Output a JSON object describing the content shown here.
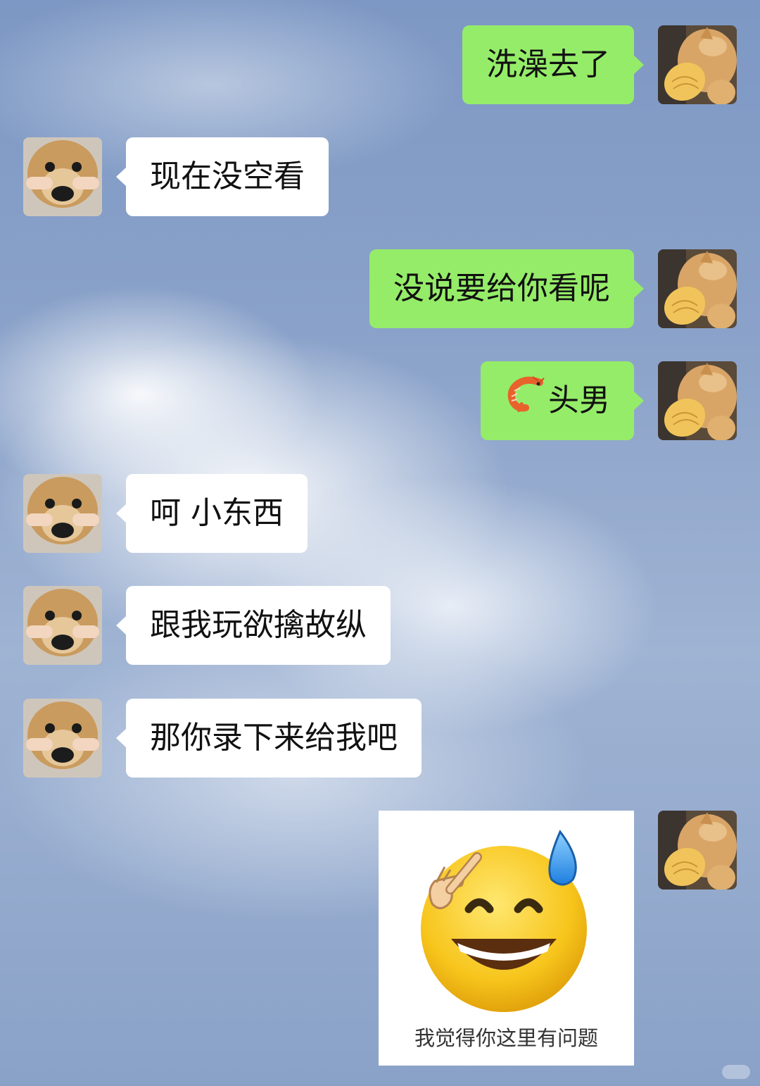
{
  "messages": [
    {
      "side": "out",
      "text": "洗澡去了"
    },
    {
      "side": "in",
      "text": "现在没空看"
    },
    {
      "side": "out",
      "text": "没说要给你看呢"
    },
    {
      "side": "out",
      "text": "头男",
      "prefix_icon": "shrimp-emoji"
    },
    {
      "side": "in",
      "text": "呵 小东西"
    },
    {
      "side": "in",
      "text": "跟我玩欲擒故纵"
    },
    {
      "side": "in",
      "text": "那你录下来给我吧"
    },
    {
      "side": "out",
      "type": "sticker",
      "icon": "sweat-smile-pointing-emoji",
      "caption": "我觉得你这里有问题"
    }
  ],
  "avatars": {
    "self": "cat-avatar-icon",
    "other": "dog-avatar-icon"
  },
  "colors": {
    "outgoing_bubble": "#95ec69",
    "incoming_bubble": "#ffffff",
    "text": "#111111"
  }
}
